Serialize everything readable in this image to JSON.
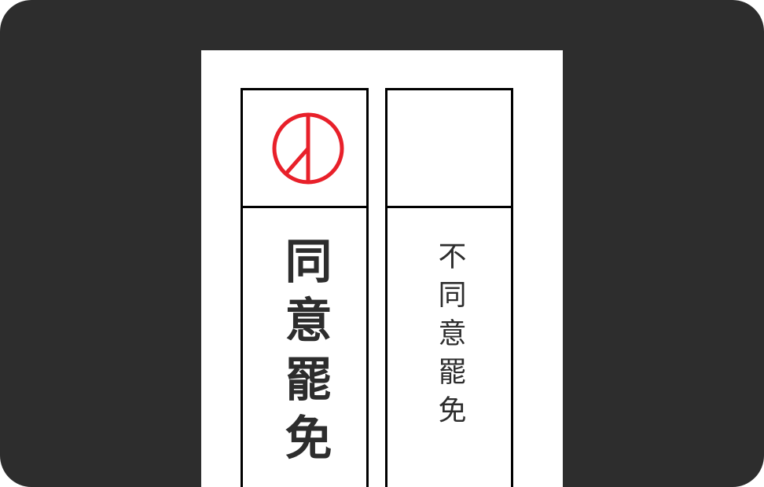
{
  "ballot": {
    "options": [
      {
        "label": "同意罷免",
        "marked": true
      },
      {
        "label": "不同意罷免",
        "marked": false
      }
    ],
    "stamp": {
      "icon": "voting-stamp-icon",
      "color": "#e8202a"
    }
  },
  "colors": {
    "frame_background": "#2d2d2d",
    "paper": "#ffffff",
    "grid_lines": "#000000",
    "text": "#2d2d2d"
  }
}
